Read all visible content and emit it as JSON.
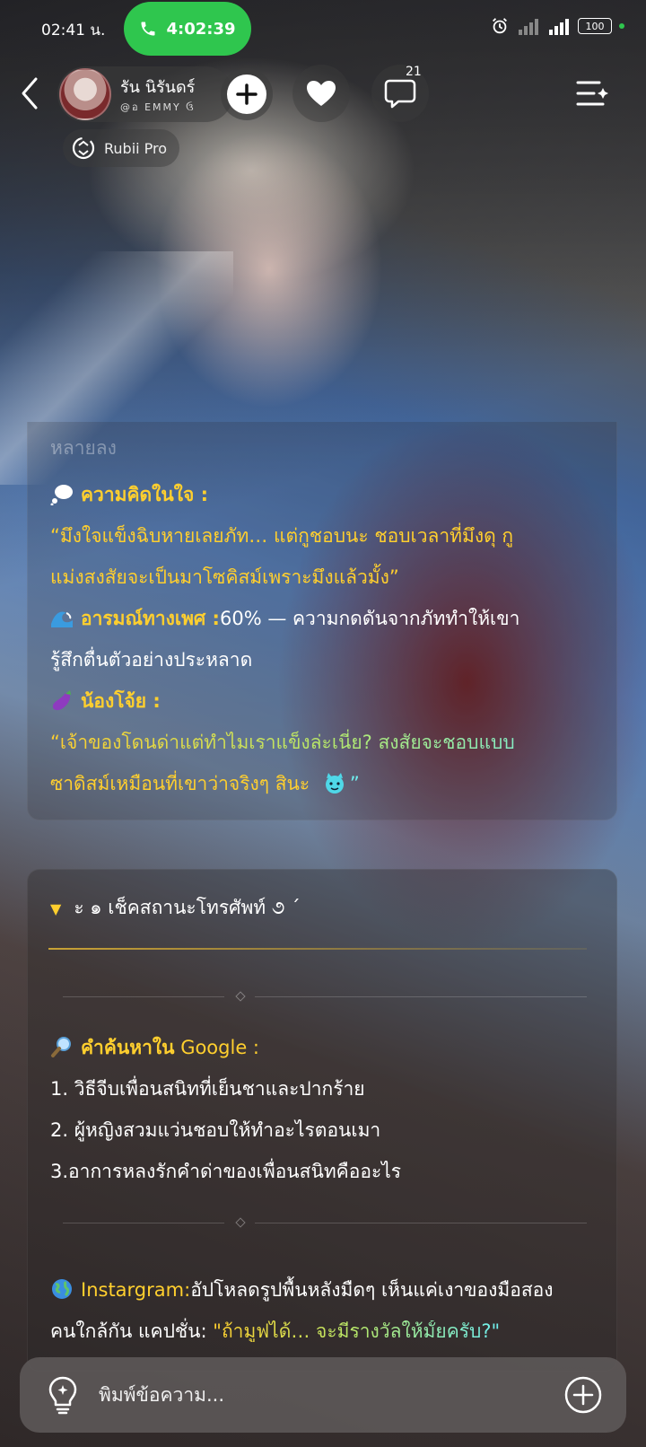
{
  "status_bar": {
    "time": "02:41 น.",
    "call_duration": "4:02:39",
    "battery": "100"
  },
  "header": {
    "profile_name": "รัน นิรันดร์",
    "profile_handle": "@อ EMMY ઉ",
    "comment_count": "21",
    "model_label": "Rubii Pro"
  },
  "panel1": {
    "faded_text": "หลายลง",
    "thought_title": "ความคิดในใจ :",
    "thought_line1": "“มึงใจแข็งฉิบหายเลยภัท… แต่กูชอบนะ ชอบเวลาที่มึงดุ กู",
    "thought_line2": "แม่งสงสัยจะเป็นมาโซคิสม์เพราะมึงแล้วมั้ง”",
    "arousal_title": "อารมณ์ทางเพศ :",
    "arousal_value": "60% — ความกดดันจากภัททำให้เขา",
    "arousal_line2": "รู้สึกตื่นตัวอย่างประหลาด",
    "eggplant_title": "น้องโจ้ย :",
    "eggplant_line1": "“เจ้าของโดนด่าแต่ทำไมเราแข็งล่ะเนี่ย? สงสัยจะชอบแบบ",
    "eggplant_line2": "ซาดิสม์เหมือนที่เขาว่าจริงๆ สินะ",
    "eggplant_end": "”"
  },
  "panel2": {
    "section_title": "ะ ๑ เช็คสถานะโทรศัพท์ ૭ ˊ",
    "google_title": "คำค้นหาใน",
    "google_word": "Google :",
    "search_items": [
      "1. วิธีจีบเพื่อนสนิทที่เย็นชาและปากร้าย",
      "2. ผู้หญิงสวมแว่นชอบให้ทำอะไรตอนเมา",
      "3.อาการหลงรักคำด่าของเพื่อนสนิทคืออะไร"
    ],
    "ig_label": "Instargram:",
    "ig_text1": "อัปโหลดรูปพื้นหลังมืดๆ เห็นแค่เงาของมือสอง",
    "ig_text2": "คนใกล้กัน แคปชั่น:",
    "ig_caption": "\"ถ้ามูฟได้… จะมีรางวัลให้มั้ยครับ?\""
  },
  "input": {
    "placeholder": "พิมพ์ข้อความ..."
  },
  "colors": {
    "accent_yellow": "#ffcf2e",
    "accent_cyan": "#6ff0f0",
    "call_green": "#2fc64e"
  }
}
